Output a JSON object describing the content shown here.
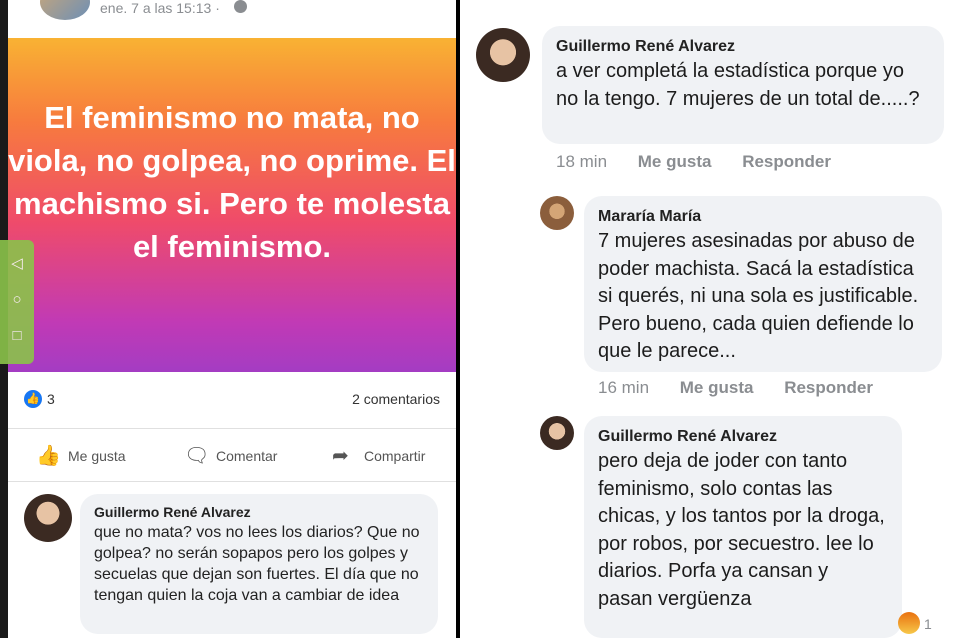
{
  "post": {
    "time": "ene. 7 a las 15:13 ·",
    "text": "El feminismo no mata, no viola, no golpea, no oprime. El machismo si. Pero te molesta el feminismo.",
    "likes": "3",
    "comments_count": "2 comentarios",
    "actions": {
      "like": "Me gusta",
      "comment": "Comentar",
      "share": "Compartir"
    }
  },
  "left_comment": {
    "name": "Guillermo René Alvarez",
    "text": "que no mata? vos no lees los diarios? Que no golpea? no serán sopapos pero los golpes y secuelas que dejan son fuertes. El día que no tengan quien la coja van a cambiar de idea"
  },
  "nav": {
    "back": "◁",
    "home": "○",
    "recent": "□"
  },
  "comments": [
    {
      "name": "Guillermo René Alvarez",
      "text": "a ver completá la estadística porque yo no la tengo. 7 mujeres de un total de.....?",
      "time": "18 min",
      "like": "Me gusta",
      "reply": "Responder"
    },
    {
      "name": "Mararía María",
      "text": "7 mujeres asesinadas por abuso de poder machista. Sacá la estadística si querés, ni una sola es justificable. Pero bueno, cada quien defiende lo que le parece...",
      "time": "16 min",
      "like": "Me gusta",
      "reply": "Responder"
    },
    {
      "name": "Guillermo René Alvarez",
      "text": "pero deja de joder con tanto feminismo, solo contas las chicas, y los tantos por la droga, por robos, por secuestro. lee lo diarios. Porfa ya cansan y pasan vergüenza",
      "reaction_count": "1"
    }
  ]
}
